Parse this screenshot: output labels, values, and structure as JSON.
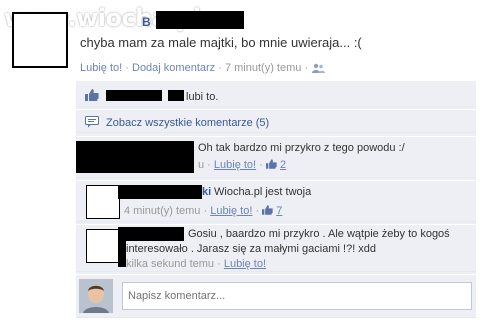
{
  "watermark": {
    "text": "www.wiocha.pl"
  },
  "post": {
    "author_tail": "B",
    "text": "chyba mam za male majtki, bo mnie uwieraja... :(",
    "like_link": "Lubię to!",
    "comment_link": "Dodaj komentarz",
    "time": "7 minut(y) temu",
    "sep": "·"
  },
  "likes": {
    "text": "lubi to."
  },
  "view_all": {
    "text": "Zobacz wszystkie komentarze (5)"
  },
  "comments": [
    {
      "text": "Oh tak bardzo mi przykro z tego powodu :/",
      "time_suffix": "u",
      "like_link": "Lubię to!",
      "like_count": "2"
    },
    {
      "author_tail": "ki",
      "text": "Wiocha.pl jest twoja",
      "time": "4 minut(y) temu",
      "like_link": "Lubię to!",
      "like_count": "7"
    },
    {
      "line1": "Gosiu , baardzo mi przykro . Ale wątpie żeby to kogoś",
      "line2": "interesowało . Jarasz się za małymi gaciami !?! xdd",
      "time": "kilka sekund temu",
      "like_link": "Lubię to!"
    }
  ],
  "comment_input": {
    "placeholder": "Napisz komentarz..."
  },
  "colors": {
    "link": "#3b5998",
    "meta": "#999999",
    "panel": "#edeff4"
  }
}
